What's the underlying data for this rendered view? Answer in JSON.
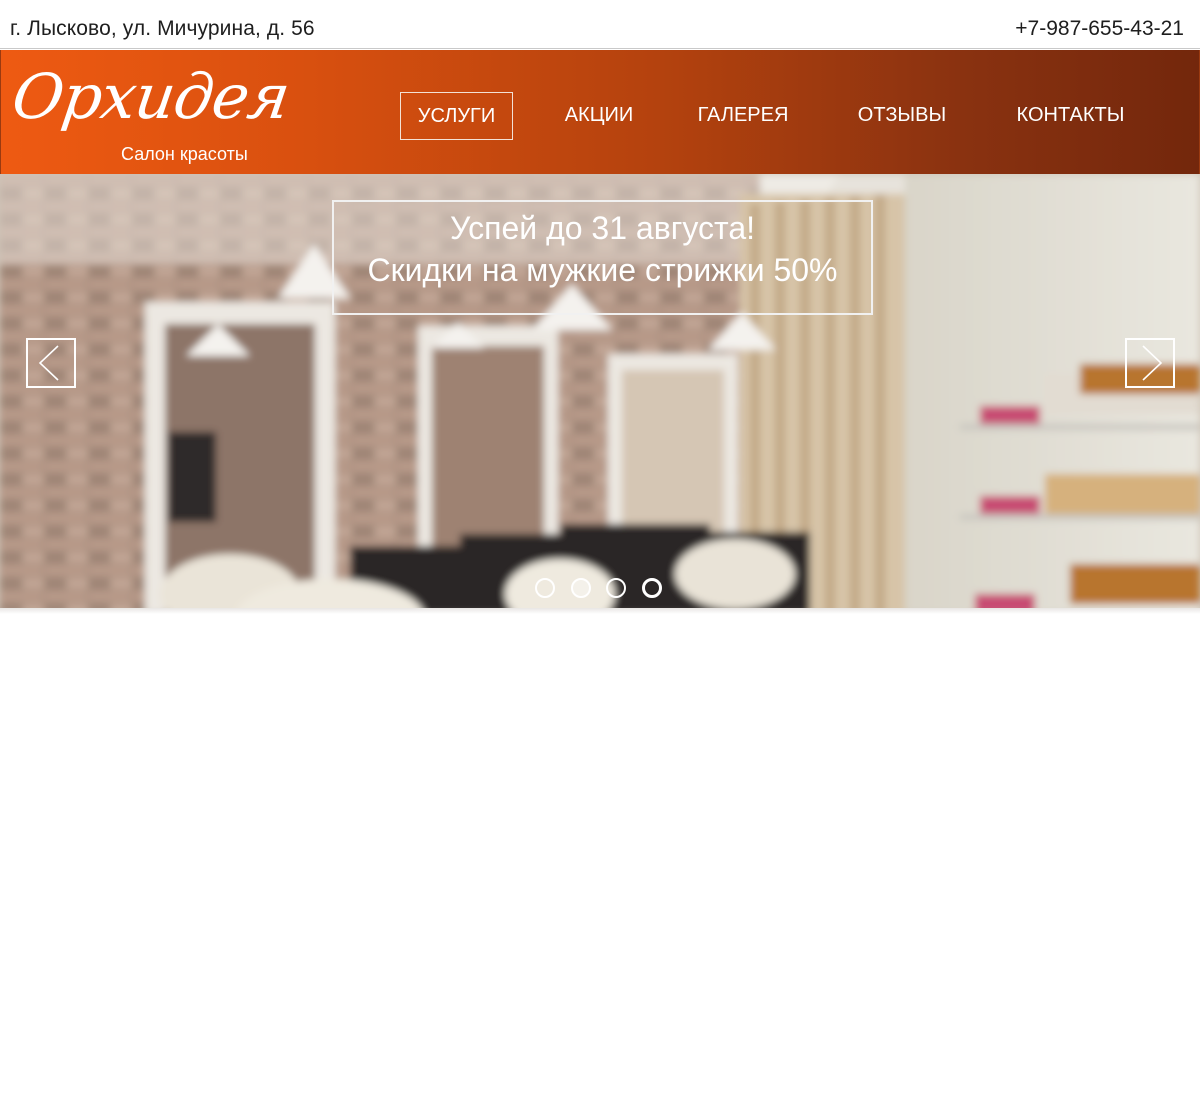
{
  "topbar": {
    "address": "г. Лысково, ул. Мичурина, д. 56",
    "phone": "+7-987-655-43-21"
  },
  "logo": {
    "name": "Орхидея",
    "tagline": "Салон красоты"
  },
  "nav": {
    "items": [
      {
        "label": "УСЛУГИ",
        "active": true
      },
      {
        "label": "АКЦИИ",
        "active": false
      },
      {
        "label": "ГАЛЕРЕЯ",
        "active": false
      },
      {
        "label": "ОТЗЫВЫ",
        "active": false
      },
      {
        "label": "КОНТАКТЫ",
        "active": false
      }
    ]
  },
  "slider": {
    "promo_line1": "Успей до 31 августа!",
    "promo_line2": "Скидки на мужкие стрижки 50%",
    "prev_icon": "chevron-left-icon",
    "next_icon": "chevron-right-icon",
    "slide_count": 4,
    "active_slide": 2
  },
  "colors": {
    "header_start": "#ee5a12",
    "header_end": "#73270c",
    "text_light": "#ffffff"
  }
}
